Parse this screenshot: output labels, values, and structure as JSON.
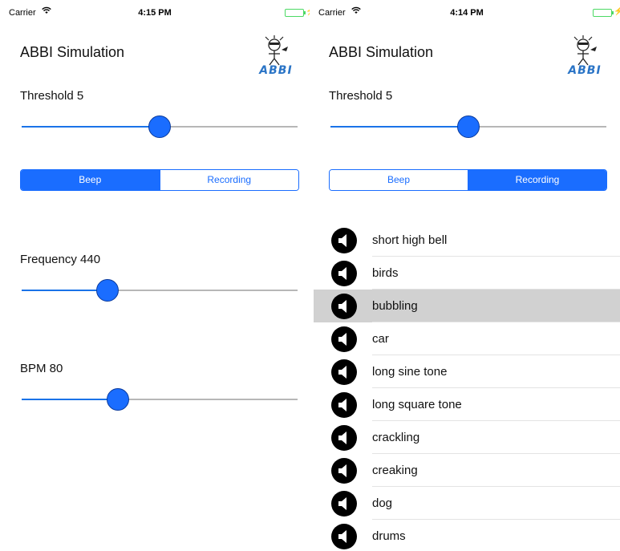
{
  "left_screen": {
    "status": {
      "carrier": "Carrier",
      "time": "4:15 PM"
    },
    "title": "ABBI Simulation",
    "logo_text": "ABBI",
    "threshold": {
      "label": "Threshold 5",
      "fraction": 0.5
    },
    "segments": {
      "beep": "Beep",
      "recording": "Recording",
      "selected": "Beep"
    },
    "frequency": {
      "label": "Frequency 440",
      "fraction": 0.31
    },
    "bpm": {
      "label": "BPM 80",
      "fraction": 0.35
    }
  },
  "right_screen": {
    "status": {
      "carrier": "Carrier",
      "time": "4:14 PM"
    },
    "title": "ABBI Simulation",
    "logo_text": "ABBI",
    "threshold": {
      "label": "Threshold 5",
      "fraction": 0.5
    },
    "segments": {
      "beep": "Beep",
      "recording": "Recording",
      "selected": "Recording"
    },
    "sounds": [
      {
        "name": "short high bell"
      },
      {
        "name": "birds"
      },
      {
        "name": "bubbling",
        "selected": true
      },
      {
        "name": "car"
      },
      {
        "name": "long sine tone"
      },
      {
        "name": "long square tone"
      },
      {
        "name": "crackling"
      },
      {
        "name": "creaking"
      },
      {
        "name": "dog"
      },
      {
        "name": "drums"
      }
    ]
  },
  "colors": {
    "accent": "#1a6dff",
    "battery": "#4cd964",
    "selected_row": "#d1d1d1"
  },
  "icons": {
    "wifi": "wifi-icon",
    "battery": "battery-icon",
    "charging": "charging-bolt-icon",
    "speaker": "speaker-icon"
  }
}
